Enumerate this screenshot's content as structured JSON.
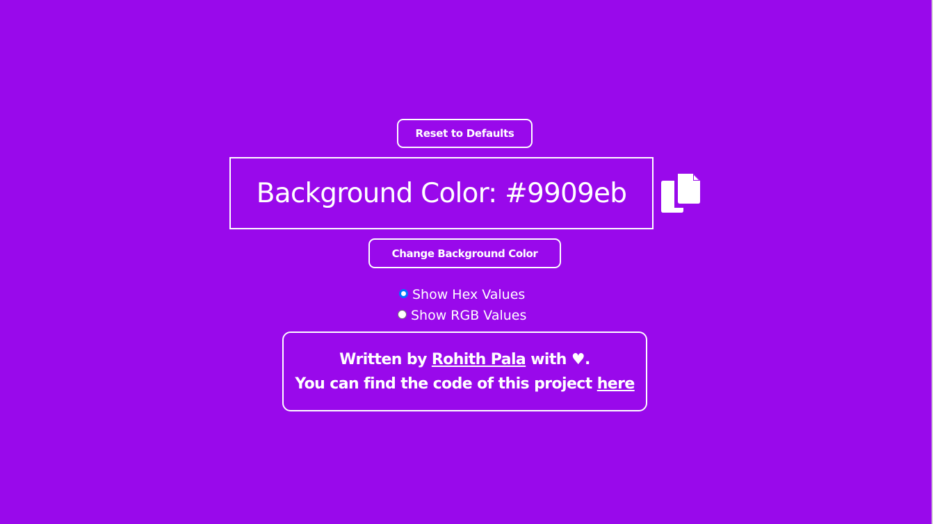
{
  "colors": {
    "background": "#9909eb",
    "foreground": "#ffffff",
    "radio_accent": "#0075ff"
  },
  "controls": {
    "reset_label": "Reset to Defaults",
    "change_label": "Change Background Color"
  },
  "display": {
    "prefix": "Background Color:",
    "value": "#9909eb",
    "copy_icon": "copy-icon"
  },
  "options": {
    "hex_label": "Show Hex Values",
    "hex_checked": true,
    "rgb_label": "Show RGB Values",
    "rgb_checked": false
  },
  "footer": {
    "written_by": "Written by",
    "author": "Rohith Pala",
    "with": "with",
    "heart": "♥.",
    "code_text": "You can find the code of this project",
    "code_link": "here"
  }
}
